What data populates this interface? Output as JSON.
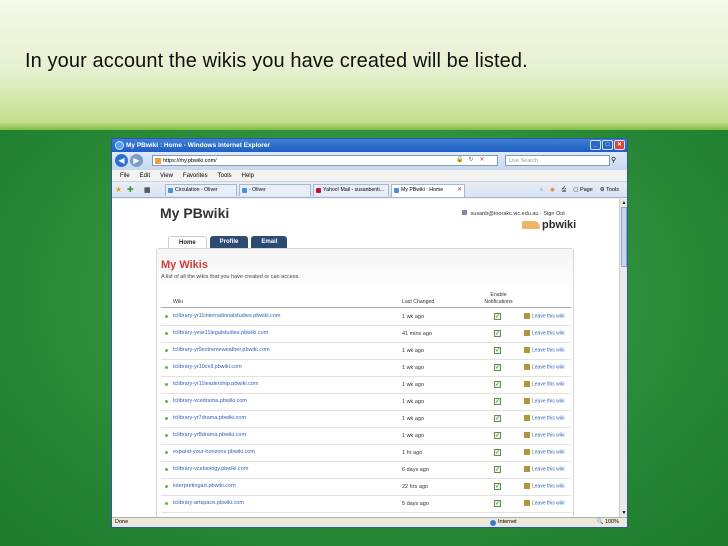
{
  "slide": {
    "title": "In your account the wikis you have created will be listed."
  },
  "browser": {
    "title": "My PBwiki : Home - Windows Internet Explorer",
    "url": "https://my.pbwiki.com/",
    "search_placeholder": "Live Search",
    "menu": [
      "File",
      "Edit",
      "View",
      "Favorites",
      "Tools",
      "Help"
    ],
    "tabs": [
      {
        "label": "Circulation - Oliver"
      },
      {
        "label": "- Oliver"
      },
      {
        "label": "Yahoo! Mail - susanbenti..."
      },
      {
        "label": "My PBwiki : Home"
      }
    ],
    "tools": {
      "page": "Page",
      "tools": "Tools"
    },
    "status": {
      "left": "Done",
      "zone": "Internet",
      "zoom": "100%"
    }
  },
  "page": {
    "header": "My PBwiki",
    "user_email": "susanb@toorakc.vic.edu.au",
    "sign_out": "Sign Out",
    "logo": "pbwiki",
    "nav": [
      "Home",
      "Profile",
      "Email"
    ],
    "section_title": "My Wikis",
    "description": "A list of all the wikis that you have created or can access.",
    "columns": {
      "wiki": "Wiki",
      "last_changed": "Last Changed",
      "notifications": "Enable Notifications"
    },
    "leave_label": "Leave this wiki",
    "rows": [
      {
        "name": "tclibrary-yr11internationalstudies.pbwiki.com",
        "when": "1 wk ago"
      },
      {
        "name": "tclibrary-year11legalstudies.pbwiki.com",
        "when": "41 mins ago"
      },
      {
        "name": "tclibrary-yr9extremeweather.pbwiki.com",
        "when": "1 wk ago"
      },
      {
        "name": "tclibrary-yr10cell.pbwiki.com",
        "when": "1 wk ago"
      },
      {
        "name": "tclibrary-yr11leadership.pbwiki.com",
        "when": "1 wk ago"
      },
      {
        "name": "tclibrary-vcedrama.pbwiki.com",
        "when": "1 wk ago"
      },
      {
        "name": "tclibrary-yr7drama.pbwiki.com",
        "when": "1 wk ago"
      },
      {
        "name": "tclibrary-yr8drama.pbwiki.com",
        "when": "1 wk ago"
      },
      {
        "name": "expand-your-horizons.pbwiki.com",
        "when": "1 hr ago"
      },
      {
        "name": "tclibrary-vcebiology.pbwiki.com",
        "when": "6 days ago"
      },
      {
        "name": "interpretingart.pbwiki.com",
        "when": "22 hrs ago"
      },
      {
        "name": "tclibrary-artspace.pbwiki.com",
        "when": "5 days ago"
      }
    ]
  }
}
